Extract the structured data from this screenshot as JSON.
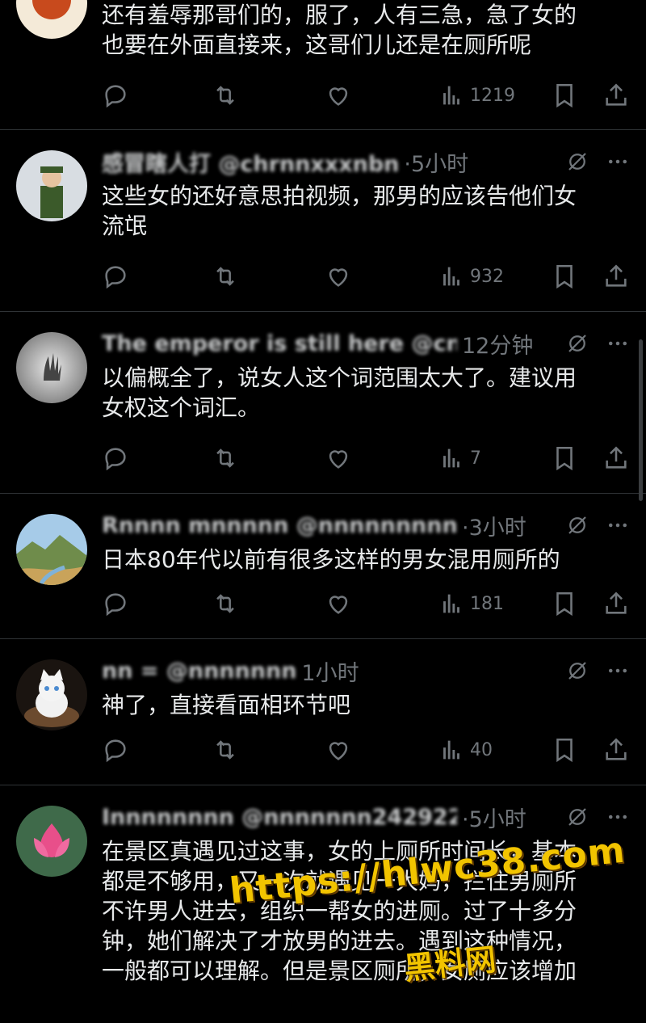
{
  "posts": [
    {
      "name": "",
      "time": "",
      "text": [
        "还有羞辱那哥们的，服了，人有三急，急了女的",
        "也要在外面直接来，这哥们儿还是在厕所呢"
      ],
      "views": "1219"
    },
    {
      "name": "感冒瞎人打 @chrnnxxxnbn",
      "time": "·5小时",
      "text": [
        "这些女的还好意思拍视频，那男的应该告他们女",
        "流氓"
      ],
      "views": "932"
    },
    {
      "name": "The emperor is still here @cnnnnn",
      "time": "12分钟",
      "text": [
        "以偏概全了，说女人这个词范围太大了。建议用",
        "女权这个词汇。"
      ],
      "views": "7"
    },
    {
      "name": "Rnnnn mnnnnn @nnnnnnnnnnnn",
      "time": "·3小时",
      "text": [
        "日本80年代以前有很多这样的男女混用厕所的"
      ],
      "views": "181"
    },
    {
      "name": "nn = @nnnnnnn",
      "time": "1小时",
      "text": [
        "神了，直接看面相环节吧"
      ],
      "views": "40"
    },
    {
      "name": "Innnnnnnn @nnnnnnn2429229",
      "time": "·5小时",
      "text": [
        "在景区真遇见过这事，女的上厕所时间长，基本",
        "都是不够用，又一次就遇见一大妈，拦住男厕所",
        "不许男人进去，组织一帮女的进厕。过了十多分",
        "钟，她们解决了才放男的进去。遇到这种情况，",
        "一般都可以理解。但是景区厕所，女厕应该增加"
      ],
      "views": ""
    }
  ],
  "watermark": {
    "url": "https://hlwc38.com",
    "brand": "黑料网"
  },
  "icons": [
    "reply-icon",
    "retweet-icon",
    "like-icon",
    "views-icon",
    "bookmark-icon",
    "share-icon",
    "grok-icon",
    "more-icon"
  ],
  "colors": {
    "background": "#000000",
    "text": "#e7e9ea",
    "muted": "#71767b",
    "divider": "#2f3336",
    "watermark": "#f2c400"
  }
}
